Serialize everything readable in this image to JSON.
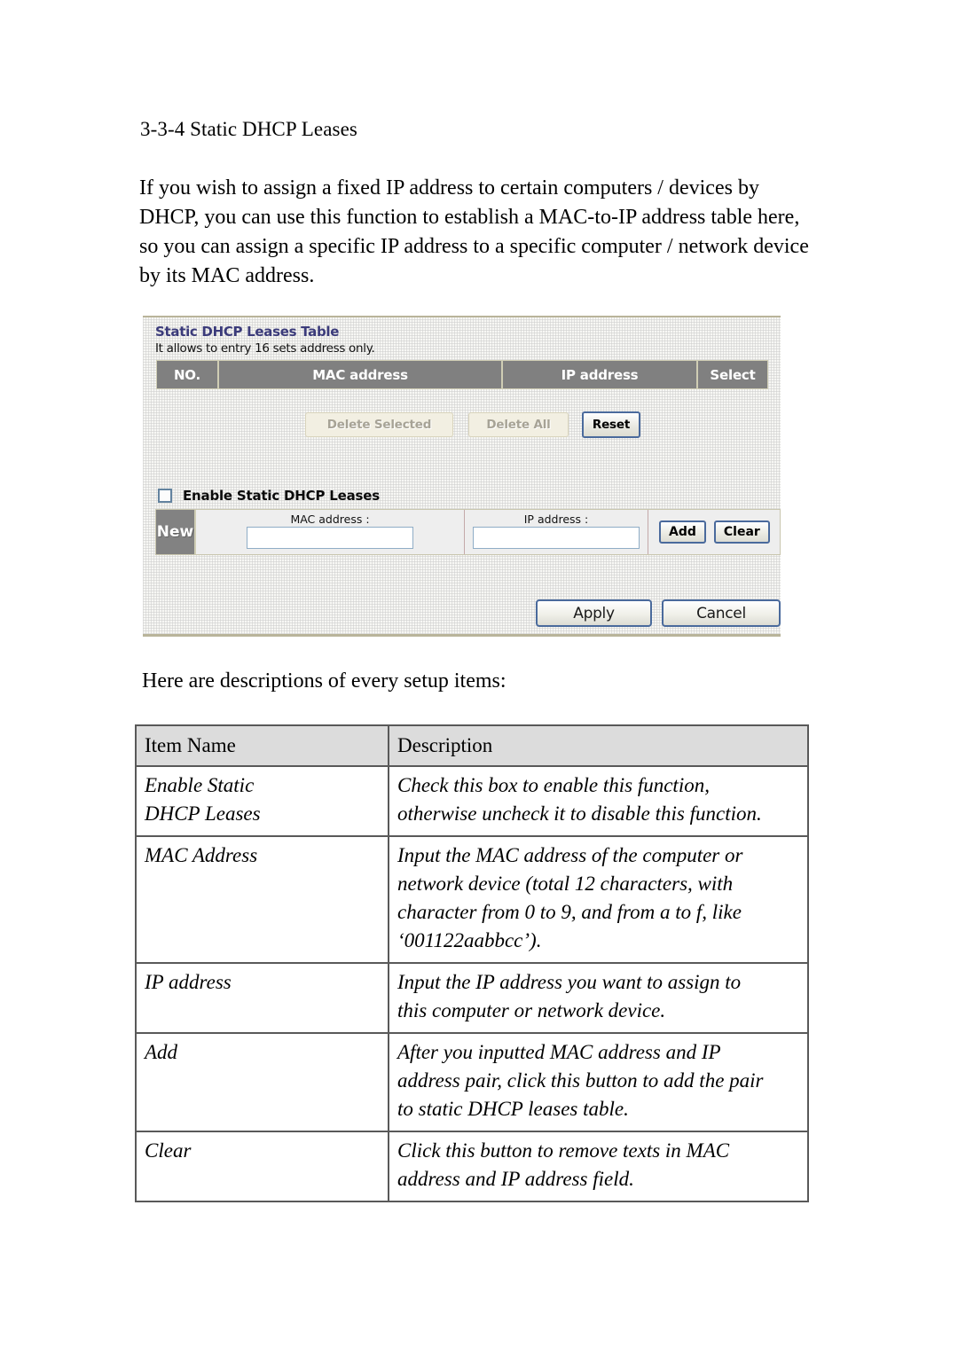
{
  "document": {
    "heading": "3-3-4 Static DHCP Leases",
    "intro_paragraph": "If you wish to assign a fixed IP address to certain computers / devices by DHCP, you can use this function to establish a MAC-to-IP address table here, so you can assign a specific IP address to a specific computer / network device by its MAC address.",
    "descriptions_intro": "Here are descriptions of every setup items:"
  },
  "screenshot": {
    "panel_title": "Static DHCP Leases Table",
    "panel_subtitle": "It allows to entry 16 sets address only.",
    "table_headers": {
      "no": "NO.",
      "mac_address": "MAC address",
      "ip_address": "IP address",
      "select": "Select"
    },
    "buttons": {
      "delete_selected": "Delete Selected",
      "delete_all": "Delete All",
      "reset": "Reset",
      "add": "Add",
      "clear": "Clear",
      "apply": "Apply",
      "cancel": "Cancel"
    },
    "enable_checkbox_label": "Enable Static DHCP Leases",
    "enable_checkbox_checked": "false",
    "new_row": {
      "tag": "New",
      "mac_label": "MAC address :",
      "mac_value": "",
      "ip_label": "IP address :",
      "ip_value": ""
    },
    "colors": {
      "title_blue": "#3b3b7a",
      "header_gray": "#808080",
      "panel_background": "#f7f7f4",
      "button_border_blue": "#4a6a9c",
      "disabled_button_bg": "#f2efe2"
    }
  },
  "desc_table": {
    "headers": [
      "Item Name",
      "Description"
    ],
    "rows": [
      {
        "item": [
          "Enable Static",
          "DHCP Leases"
        ],
        "description": [
          "Check this box to enable this function,",
          "otherwise uncheck it to disable this function."
        ]
      },
      {
        "item": [
          "MAC Address"
        ],
        "description": [
          "Input the MAC address of the computer or",
          "network device (total 12 characters, with",
          "character from 0 to 9, and from a to f, like",
          "‘001122aabbcc’)."
        ]
      },
      {
        "item": [
          "IP address"
        ],
        "description": [
          "Input the IP address you want to assign to",
          "this computer or network device."
        ]
      },
      {
        "item": [
          "Add"
        ],
        "description": [
          "After you inputted MAC address and IP",
          "address pair, click this button to add the pair",
          "to static DHCP leases table."
        ]
      },
      {
        "item": [
          "Clear"
        ],
        "description": [
          "Click this button to remove texts in MAC",
          "address and IP address field."
        ]
      }
    ]
  }
}
